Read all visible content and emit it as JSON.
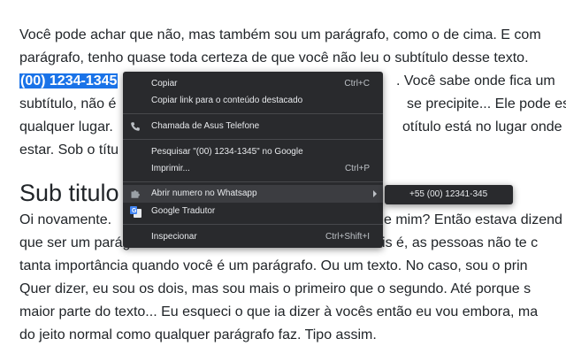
{
  "content": {
    "lines": [
      "Você pode achar que não, mas também sou um parágrafo, como o de cima. E com",
      "parágrafo, tenho quase toda certeza de que você não leu o subtítulo desse texto.",
      "",
      "subtítulo, não é",
      "qualquer lugar.",
      "estar. Sob o títu"
    ],
    "line3_selected": "(00) 1234-1345",
    "line3_after": ". Você sabe onde fica um",
    "line4_right": "se precipite... Ele pode esta",
    "line5_right": "otítulo está no lugar onde c",
    "heading": "Sub titulo",
    "lines2": [
      "Oi novamente.",
      "que ser um parágrafo não é a melhor coisa do mundo. Pois é, as pessoas não te c",
      "tanta importância quando você é um parágrafo. Ou um texto. No caso, sou o prin",
      "Quer dizer, eu sou os dois, mas sou mais o primeiro que o segundo. Até porque s",
      "maior parte do texto... Eu esqueci o que ia dizer à vocês então eu vou embora, ma",
      "do jeito normal como qualquer parágrafo faz. Tipo assim."
    ],
    "line7_right": "e mim? Então estava dizend"
  },
  "menu": {
    "copy": "Copiar",
    "copy_shortcut": "Ctrl+C",
    "copy_link": "Copiar link para o conteúdo destacado",
    "call": "Chamada de Asus Telefone",
    "search": "Pesquisar \"(00) 1234-1345\" no Google",
    "print": "Imprimir...",
    "print_shortcut": "Ctrl+P",
    "whatsapp": "Abrir numero no Whatsapp",
    "translate": "Google Tradutor",
    "inspect": "Inspecionar",
    "inspect_shortcut": "Ctrl+Shift+I"
  },
  "submenu": {
    "number": "+55 (00) 12341-345"
  },
  "icons": {
    "call": "phone-icon",
    "whatsapp": "puzzle-extension-icon",
    "translate": "google-translate-icon",
    "submenu_arrow": "chevron-right-icon"
  }
}
